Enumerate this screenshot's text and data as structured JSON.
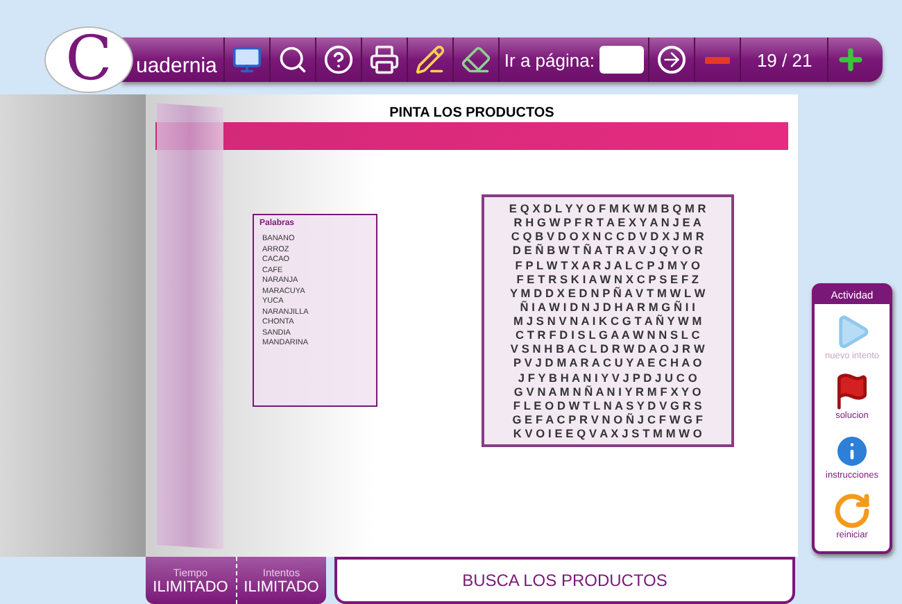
{
  "logo": {
    "initial": "C",
    "name": "uadernia"
  },
  "toolbar": {
    "buttons": [
      {
        "kind": "monitor"
      },
      {
        "kind": "zoom"
      },
      {
        "kind": "help"
      },
      {
        "kind": "print"
      },
      {
        "kind": "edit"
      },
      {
        "kind": "eraser"
      }
    ],
    "goto_label": "Ir a página:",
    "page_indicator": "19 / 21"
  },
  "page": {
    "title": "PINTA LOS PRODUCTOS",
    "word_list": {
      "heading": "Palabras",
      "words": [
        "BANANO",
        "ARROZ",
        "CACAO",
        "CAFE",
        "NARANJA",
        "MARACUYA",
        "YUCA",
        "NARANJILLA",
        "CHONTA",
        "SANDIA",
        "MANDARINA"
      ]
    },
    "grid_rows": [
      "E Q X D L Y Y O F M K W M B Q M R",
      "R H G W P F R T A E X Y A N J E A",
      "C Q B V D O X N C C D V D X J M R",
      "D E Ñ B W T Ñ A T R A V J Q Y O R",
      "F P L W T X A R J A L C P J M Y O",
      "F E T R S K I A W N X C P S E F Z",
      "Y M D D X E D N P Ñ A V T M W L W",
      "Ñ I A W I D N J D H A R M G Ñ I I",
      "M J S N V N A I K C G T A Ñ Y W M",
      "C T R F D I S L G A A W N N S L C",
      "V S N H B A C L D R W D A O J R W",
      "P V J D M A R A C U Y A E C H A O",
      "J F Y B H A N I Y V J P D J U C O",
      "G V N A M N Ñ A N I Y R M F X Y O",
      "F L E O D W T L N A S Y D V G R S",
      "G E F A C P R V N O Ñ J C F W G F",
      "K V O I E E Q V A X J S T M M W O"
    ]
  },
  "activity": {
    "title": "Actividad",
    "items": [
      {
        "kind": "retry",
        "label": "nuevo intento",
        "disabled": true
      },
      {
        "kind": "solution",
        "label": "solucion",
        "disabled": false
      },
      {
        "kind": "info",
        "label": "instrucciones",
        "disabled": false
      },
      {
        "kind": "restart",
        "label": "reiniciar",
        "disabled": false
      }
    ]
  },
  "status": {
    "time_label": "Tiempo",
    "time_value": "ILIMITADO",
    "tries_label": "Intentos",
    "tries_value": "ILIMITADO",
    "instruction": "BUSCA LOS PRODUCTOS"
  }
}
